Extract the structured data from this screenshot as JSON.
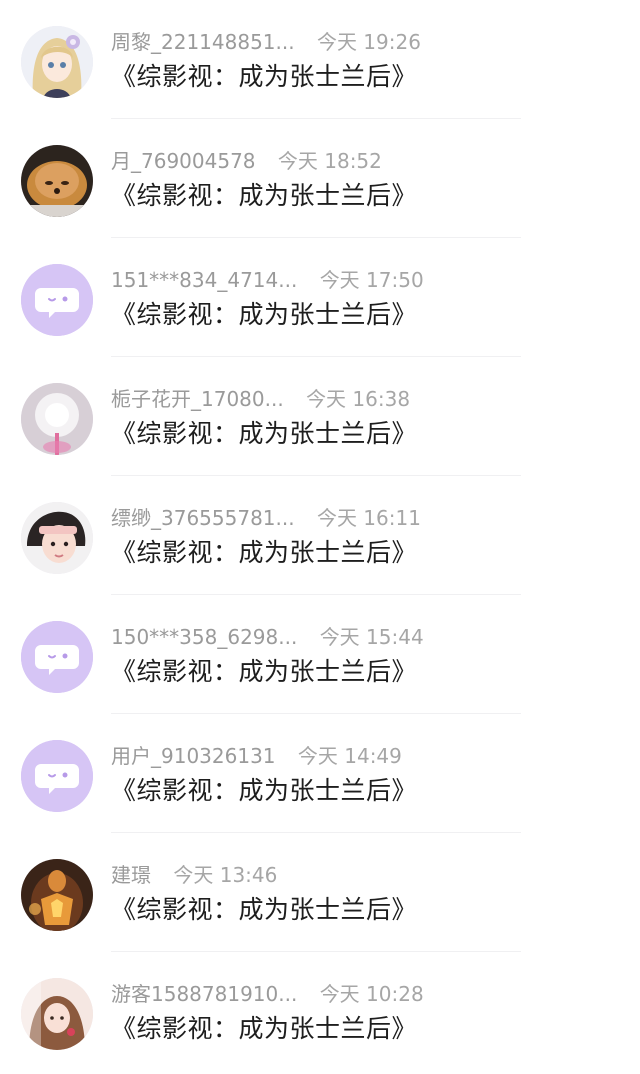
{
  "comments": [
    {
      "name": "周黎_221148851...",
      "time": "今天 19:26",
      "text": "《综影视：成为张士兰后》",
      "avatar": "anime-girl-avatar"
    },
    {
      "name": "月_769004578",
      "time": "今天 18:52",
      "text": "《综影视：成为张士兰后》",
      "avatar": "puppy-avatar"
    },
    {
      "name": "151***834_4714...",
      "time": "今天 17:50",
      "text": "《综影视：成为张士兰后》",
      "avatar": "default-chat-bubble-avatar"
    },
    {
      "name": "栀子花开_17080...",
      "time": "今天 16:38",
      "text": "《综影视：成为张士兰后》",
      "avatar": "dandelion-avatar"
    },
    {
      "name": "缥缈_376555781...",
      "time": "今天 16:11",
      "text": "《综影视：成为张士兰后》",
      "avatar": "child-photo-avatar"
    },
    {
      "name": "150***358_6298...",
      "time": "今天 15:44",
      "text": "《综影视：成为张士兰后》",
      "avatar": "default-chat-bubble-avatar"
    },
    {
      "name": "用户_910326131",
      "time": "今天 14:49",
      "text": "《综影视：成为张士兰后》",
      "avatar": "default-chat-bubble-avatar"
    },
    {
      "name": "建璟",
      "time": "今天 13:46",
      "text": "《综影视：成为张士兰后》",
      "avatar": "armored-hero-avatar"
    },
    {
      "name": "游客1588781910...",
      "time": "今天 10:28",
      "text": "《综影视：成为张士兰后》",
      "avatar": "girl-portrait-avatar"
    }
  ],
  "colors": {
    "default_avatar_bg": "#d6c5f5",
    "name_text": "#9a9a9a",
    "comment_text": "#1e1e1e"
  }
}
